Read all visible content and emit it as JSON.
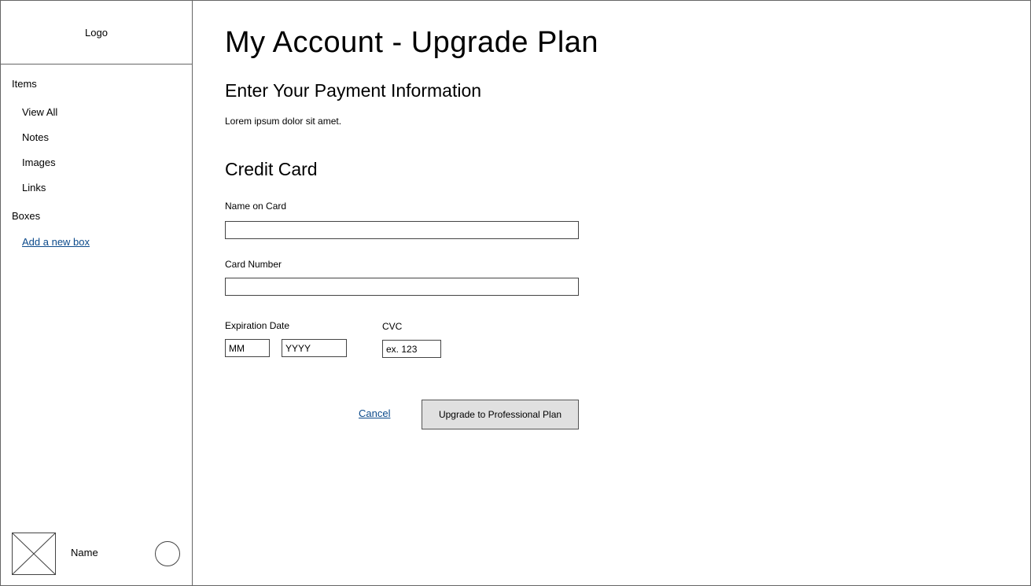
{
  "sidebar": {
    "logo": "Logo",
    "sections": [
      {
        "label": "Items"
      },
      {
        "label": "Boxes"
      }
    ],
    "items": [
      {
        "label": "View All"
      },
      {
        "label": "Notes"
      },
      {
        "label": "Images"
      },
      {
        "label": "Links"
      }
    ],
    "add_box_link": "Add a new box",
    "user": {
      "name": "Name"
    }
  },
  "main": {
    "title": "My Account - Upgrade Plan",
    "section_title": "Enter Your Payment Information",
    "description": "Lorem ipsum dolor sit amet.",
    "credit_card": {
      "title": "Credit Card",
      "name_label": "Name on Card",
      "name_value": "",
      "number_label": "Card Number",
      "number_value": "",
      "expiration_label": "Expiration Date",
      "month_placeholder": "MM",
      "year_placeholder": "YYYY",
      "cvc_label": "CVC",
      "cvc_placeholder": "ex. 123"
    },
    "actions": {
      "cancel": "Cancel",
      "upgrade": "Upgrade to Professional Plan"
    }
  }
}
